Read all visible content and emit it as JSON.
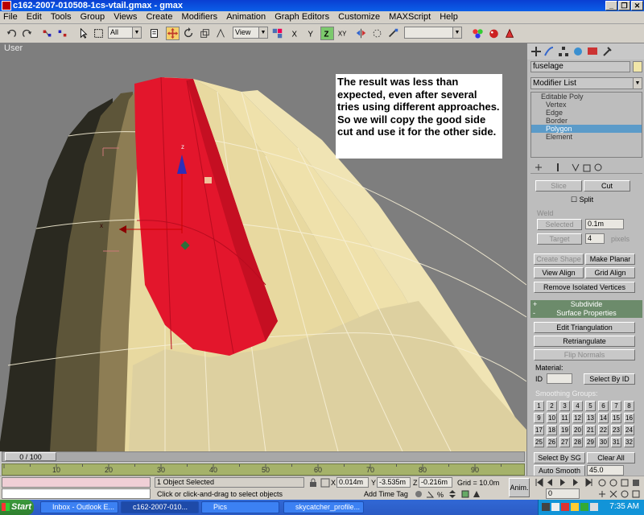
{
  "window": {
    "title": "c162-2007-010508-1cs-vtail.gmax - gmax"
  },
  "menubar": [
    "File",
    "Edit",
    "Tools",
    "Group",
    "Views",
    "Create",
    "Modifiers",
    "Animation",
    "Graph Editors",
    "Customize",
    "MAXScript",
    "Help"
  ],
  "toolbar": {
    "selection_filter": "All",
    "reference_coord": "View",
    "named_selection": ""
  },
  "viewport": {
    "label": "User",
    "axis_z": "z",
    "axis_x": "x"
  },
  "note": {
    "text": "The result was less than expected, even after several tries using different approaches.  So we will copy the good side cut and use it for the other side."
  },
  "command_panel": {
    "object_name": "fuselage",
    "modifier_list": "Modifier List",
    "stack": {
      "root": "Editable Poly",
      "items": [
        "Vertex",
        "Edge",
        "Border",
        "Polygon",
        "Element"
      ],
      "selected": "Polygon"
    },
    "buttons": {
      "slice": "Slice",
      "cut": "Cut",
      "split": "Split",
      "weld_label": "Weld",
      "selected": "Selected",
      "weld_value": "0.1m",
      "target": "Target",
      "target_value": "4",
      "pixels": "pixels",
      "create_shape": "Create Shape",
      "make_planar": "Make Planar",
      "view_align": "View Align",
      "grid_align": "Grid Align",
      "remove_isolated": "Remove Isolated Vertices"
    },
    "rollouts": {
      "subdivide": "Subdivide",
      "surface_properties": "Surface Properties"
    },
    "surface": {
      "edit_triangulation": "Edit Triangulation",
      "retriangulate": "Retriangulate",
      "flip_normals": "Flip Normals",
      "material_label": "Material:",
      "id_label": "ID",
      "select_by_id": "Select By ID",
      "smoothing_groups": "Smoothing Groups:",
      "groups": [
        "1",
        "2",
        "3",
        "4",
        "5",
        "6",
        "7",
        "8",
        "9",
        "10",
        "11",
        "12",
        "13",
        "14",
        "15",
        "16",
        "17",
        "18",
        "19",
        "20",
        "21",
        "22",
        "23",
        "24",
        "25",
        "26",
        "27",
        "28",
        "29",
        "30",
        "31",
        "32"
      ],
      "select_by_sg": "Select By SG",
      "clear_all": "Clear All",
      "auto_smooth": "Auto Smooth",
      "auto_smooth_value": "45.0"
    }
  },
  "timeline": {
    "frame_display": "0 / 100",
    "ticks": [
      "10",
      "20",
      "30",
      "40",
      "50",
      "60",
      "70",
      "80",
      "90"
    ]
  },
  "status": {
    "selection": "1 Object Selected",
    "prompt": "Click or click-and-drag to select objects",
    "x_label": "X",
    "x_value": "0.014m",
    "y_label": "Y",
    "y_value": "-3.535m",
    "z_label": "Z",
    "z_value": "-0.216m",
    "grid": "Grid = 10.0m",
    "add_time_tag": "Add Time Tag",
    "anim": "Anim.",
    "frame": "0"
  },
  "taskbar": {
    "start": "Start",
    "items": [
      "Inbox - Outlook E...",
      "c162-2007-010...",
      "Pics",
      "skycatcher_profile..."
    ],
    "clock": "7:35 AM"
  },
  "colors": {
    "fuselage": "#e8d9a0",
    "fuselage_shadow": "#8d7d54",
    "selected_poly": "#e3162c",
    "viewport_bg": "#7e7e7e",
    "rollout_header": "#6c8b6b"
  }
}
